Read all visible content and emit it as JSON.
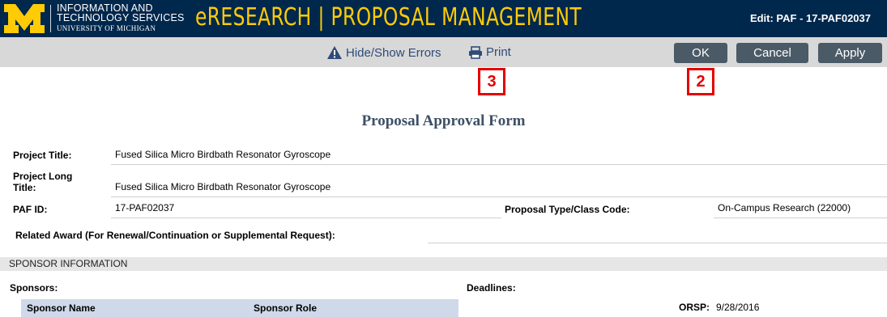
{
  "header": {
    "its_line1": "INFORMATION AND",
    "its_line2": "TECHNOLOGY SERVICES",
    "its_line3": "UNIVERSITY OF MICHIGAN",
    "app_title": "eRESEARCH | PROPOSAL MANAGEMENT",
    "edit_label": "Edit: PAF - 17-PAF02037",
    "colors": {
      "navy": "#00274c",
      "maize": "#ffcb05"
    }
  },
  "toolbar": {
    "hide_show_errors": "Hide/Show Errors",
    "print": "Print",
    "ok": "OK",
    "cancel": "Cancel",
    "apply": "Apply",
    "icons": {
      "errors": "warning-icon",
      "print": "printer-icon"
    }
  },
  "callouts": {
    "print_marker": "3",
    "ok_marker": "2",
    "color": "#e60000"
  },
  "form": {
    "title": "Proposal Approval Form",
    "project_title_label": "Project Title:",
    "project_title_value": "Fused Silica Micro Birdbath Resonator Gyroscope",
    "project_long_title_label_1": "Project Long",
    "project_long_title_label_2": "Title:",
    "project_long_title_value": "Fused Silica Micro Birdbath Resonator Gyroscope",
    "paf_id_label": "PAF ID:",
    "paf_id_value": "17-PAF02037",
    "proposal_type_label": "Proposal Type/Class Code:",
    "proposal_type_value": "On-Campus Research (22000)",
    "related_award_label": "Related Award (For Renewal/Continuation or Supplemental Request):",
    "related_award_value": ""
  },
  "sponsor_section": {
    "title": "SPONSOR INFORMATION",
    "sponsors_label": "Sponsors:",
    "deadlines_label": "Deadlines:",
    "columns": [
      "Sponsor Name",
      "Sponsor Role"
    ],
    "orsp_label": "ORSP:",
    "orsp_value": "9/28/2016"
  }
}
